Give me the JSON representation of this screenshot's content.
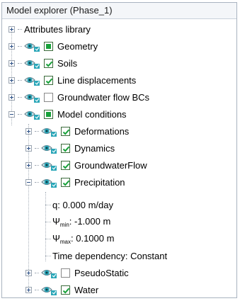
{
  "panel": {
    "title": "Model explorer (Phase_1)"
  },
  "tree": {
    "attributes_library": "Attributes library",
    "geometry": "Geometry",
    "soils": "Soils",
    "line_displacements": "Line displacements",
    "groundwater_flow_bcs": "Groundwater flow BCs",
    "model_conditions": "Model conditions",
    "deformations": "Deformations",
    "dynamics": "Dynamics",
    "groundwater_flow": "GroundwaterFlow",
    "precipitation": "Precipitation",
    "q": "q: 0.000 m/day",
    "psi_symbol": "Ψ",
    "psi_min_sub": "min",
    "psi_min_value": ": -1.000 m",
    "psi_max_sub": "max",
    "psi_max_value": ": 0.1000 m",
    "time_dependency": "Time dependency: Constant",
    "pseudo_static": "PseudoStatic",
    "water": "Water"
  },
  "colors": {
    "check_green": "#18a23a",
    "eye_teal": "#2aa6b8"
  },
  "icons": {
    "expand": "plus-box-icon",
    "collapse": "minus-box-icon",
    "visibility": "eye-icon"
  }
}
